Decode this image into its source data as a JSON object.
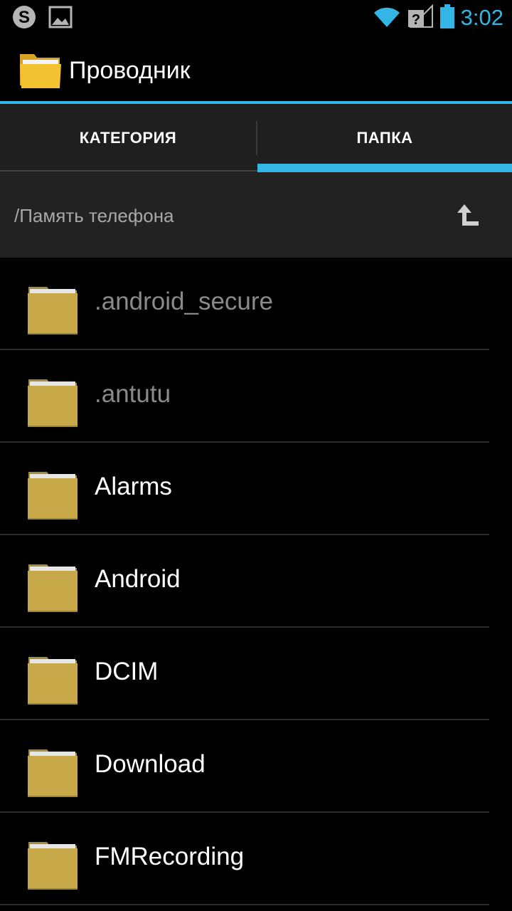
{
  "status_bar": {
    "time": "3:02",
    "icons": [
      "skype-icon",
      "image-notification-icon",
      "wifi-icon",
      "no-sim-signal-icon",
      "battery-icon"
    ],
    "accent_color": "#33b5e5"
  },
  "app": {
    "title": "Проводник",
    "icon": "folder-icon"
  },
  "tabs": [
    {
      "label": "КАТЕГОРИЯ",
      "selected": false
    },
    {
      "label": "ПАПКА",
      "selected": true
    }
  ],
  "path": {
    "current": "/Память телефона",
    "up_icon": "up-folder-icon"
  },
  "files": [
    {
      "name": ".android_secure",
      "hidden": true
    },
    {
      "name": ".antutu",
      "hidden": true
    },
    {
      "name": "Alarms",
      "hidden": false
    },
    {
      "name": "Android",
      "hidden": false
    },
    {
      "name": "DCIM",
      "hidden": false
    },
    {
      "name": "Download",
      "hidden": false
    },
    {
      "name": "FMRecording",
      "hidden": false
    }
  ],
  "colors": {
    "accent": "#33b5e5",
    "folder": "#c8a94a",
    "tab_bg": "#1f1f1f",
    "path_bg": "#222222"
  }
}
